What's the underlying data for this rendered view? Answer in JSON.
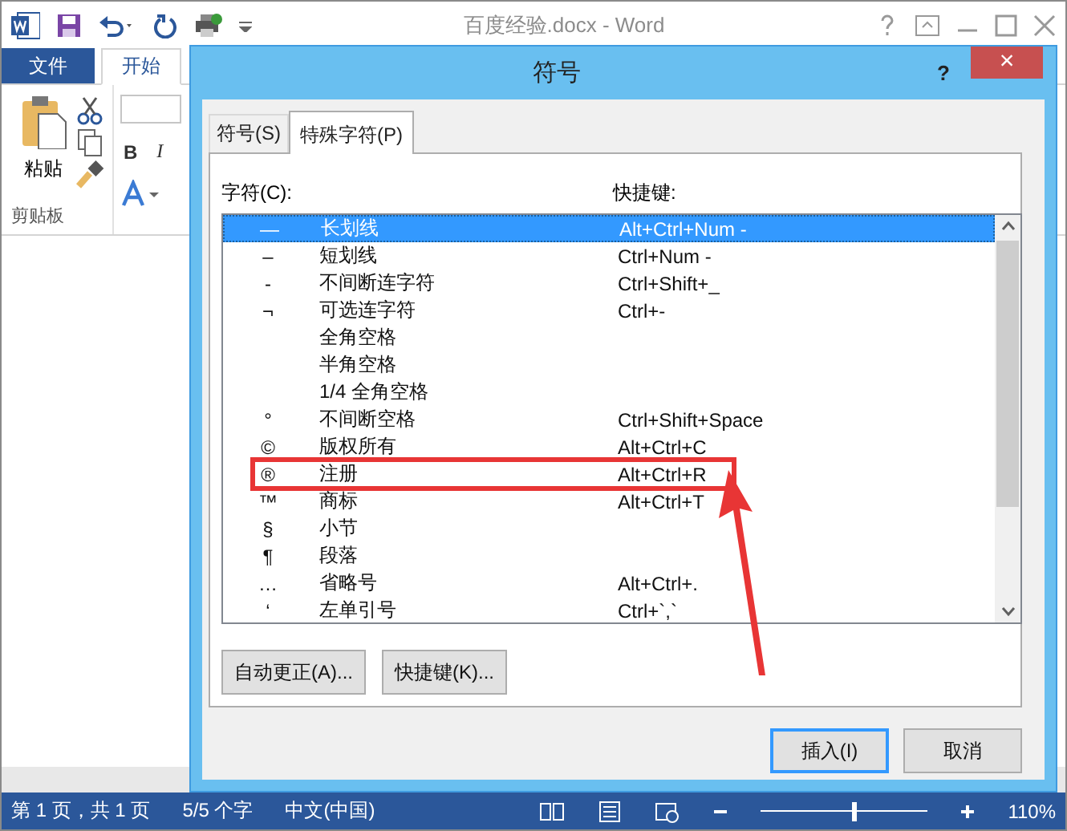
{
  "word": {
    "title": "百度经验.docx - Word",
    "tabs": [
      {
        "label": "文件",
        "kind": "file",
        "selected": false
      },
      {
        "label": "开始",
        "kind": "tab",
        "selected": true
      }
    ],
    "clipboard": {
      "paste": "粘贴",
      "group": "剪贴板"
    },
    "font_buttons": [
      "B",
      "I"
    ],
    "status_bar": {
      "page": "第 1 页，共 1 页",
      "words": "5/5 个字",
      "language": "中文(中国)",
      "zoom": "110%",
      "level": 0.55
    }
  },
  "dialog": {
    "title": "符号",
    "help": "?",
    "close": "×",
    "tabs": [
      {
        "label": "符号(S)",
        "selected": false
      },
      {
        "label": "特殊字符(P)",
        "selected": true
      }
    ],
    "columns": [
      "字符(C):",
      "快捷键:"
    ],
    "rows": [
      {
        "symbol": "—",
        "name": "长划线",
        "shortcut": "Alt+Ctrl+Num -",
        "selected": true,
        "highlighted": false
      },
      {
        "symbol": "–",
        "name": "短划线",
        "shortcut": "Ctrl+Num -",
        "selected": false,
        "highlighted": false
      },
      {
        "symbol": "-",
        "name": "不间断连字符",
        "shortcut": "Ctrl+Shift+_",
        "selected": false,
        "highlighted": false
      },
      {
        "symbol": "¬",
        "name": "可选连字符",
        "shortcut": "Ctrl+-",
        "selected": false,
        "highlighted": false
      },
      {
        "name": "全角空格",
        "selected": false,
        "highlighted": false
      },
      {
        "name": "半角空格",
        "selected": false,
        "highlighted": false
      },
      {
        "name": "1/4 全角空格",
        "selected": false,
        "highlighted": false
      },
      {
        "symbol": "°",
        "name": "不间断空格",
        "shortcut": "Ctrl+Shift+Space",
        "selected": false,
        "highlighted": false
      },
      {
        "symbol": "©",
        "name": "版权所有",
        "shortcut": "Alt+Ctrl+C",
        "selected": false,
        "highlighted": false
      },
      {
        "symbol": "®",
        "name": "注册",
        "shortcut": "Alt+Ctrl+R",
        "selected": false,
        "highlighted": true
      },
      {
        "symbol": "™",
        "name": "商标",
        "shortcut": "Alt+Ctrl+T",
        "selected": false,
        "highlighted": false
      },
      {
        "symbol": "§",
        "name": "小节",
        "selected": false,
        "highlighted": false
      },
      {
        "symbol": "¶",
        "name": "段落",
        "selected": false,
        "highlighted": false
      },
      {
        "symbol": "…",
        "name": "省略号",
        "shortcut": "Alt+Ctrl+.",
        "selected": false,
        "highlighted": false
      },
      {
        "symbol": "‘",
        "name": "左单引号",
        "shortcut": "Ctrl+`,`",
        "selected": false,
        "highlighted": false
      }
    ],
    "buttons": [
      "自动更正(A)...",
      "快捷键(K)..."
    ],
    "actions": [
      {
        "label": "插入(I)",
        "default": true
      },
      {
        "label": "取消",
        "default": false
      }
    ]
  }
}
